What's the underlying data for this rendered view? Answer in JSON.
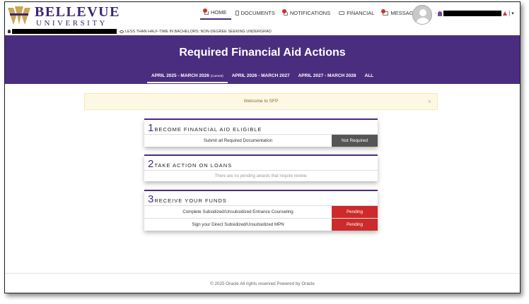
{
  "brand": {
    "name": "BELLEVUE",
    "subtitle": "UNIVERSITY"
  },
  "nav": [
    {
      "label": "HOME",
      "icon": "home-icon",
      "badge": "",
      "active": true
    },
    {
      "label": "DOCUMENTS",
      "icon": "document-icon",
      "badge": "",
      "active": false
    },
    {
      "label": "NOTIFICATIONS",
      "icon": "bell-icon",
      "badge": "",
      "active": false
    },
    {
      "label": "FINANCIAL",
      "icon": "card-icon",
      "badge": "",
      "active": false
    },
    {
      "label": "MESSAGES",
      "icon": "mail-icon",
      "badge": "",
      "active": false
    }
  ],
  "user": {
    "caret": "▾"
  },
  "enrollment_status": "LESS THAN HALF-TIME IN BACHELORS: NON-DEGREE SEEKING UNDERGRAD",
  "page_title": "Required Financial Aid Actions",
  "aid_year_tabs": [
    {
      "label": "APRIL 2025 - MARCH 2026",
      "tag": "(Current)",
      "active": true
    },
    {
      "label": "APRIL 2026 - MARCH 2027",
      "tag": "",
      "active": false
    },
    {
      "label": "APRIL 2027 - MARCH 2028",
      "tag": "",
      "active": false
    },
    {
      "label": "ALL",
      "tag": "",
      "active": false
    }
  ],
  "alert": {
    "message": "Welcome to SFP",
    "close": "×"
  },
  "steps": [
    {
      "number": "1",
      "title": "BECOME FINANCIAL AID ELIGIBLE",
      "rows": [
        {
          "label": "Submit all Required Documentation",
          "status": "Not Required"
        }
      ]
    },
    {
      "number": "2",
      "title": "TAKE ACTION ON LOANS",
      "empty_message": "There are no pending awards that require review."
    },
    {
      "number": "3",
      "title": "RECEIVE YOUR FUNDS",
      "rows": [
        {
          "label": "Complete Subsidized/Unsubsidized Entrance Counseling",
          "status": "Pending"
        },
        {
          "label": "Sign your Direct Subsidized/Unsubsidized MPN",
          "status": "Pending"
        }
      ]
    }
  ],
  "status_colors": {
    "not_required": "#555555",
    "pending": "#cc2b2b",
    "brand": "#4b2d80"
  },
  "footer": "© 2025 Oracle All rights reserved Powered by Oracle"
}
